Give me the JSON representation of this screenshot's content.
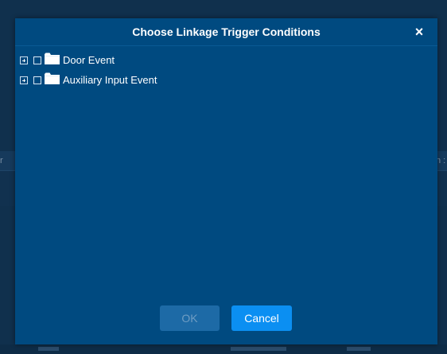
{
  "dialog": {
    "title": "Choose Linkage Trigger Conditions",
    "close_glyph": "×",
    "tree": [
      {
        "label": "Door Event",
        "expander_icon": "plus-square-icon",
        "icon": "folder-icon",
        "checked": false
      },
      {
        "label": "Auxiliary Input Event",
        "expander_icon": "plus-square-icon",
        "icon": "folder-icon",
        "checked": false
      }
    ],
    "ok_label": "OK",
    "cancel_label": "Cancel"
  },
  "background": {
    "left_fragment": "r",
    "right_fragment": "n :"
  },
  "colors": {
    "dialog_background": "#004a80",
    "page_background": "#10304d",
    "cancel_button": "#0b8ff2",
    "ok_button_disabled": "#1d6aa6",
    "text": "#ffffff"
  }
}
